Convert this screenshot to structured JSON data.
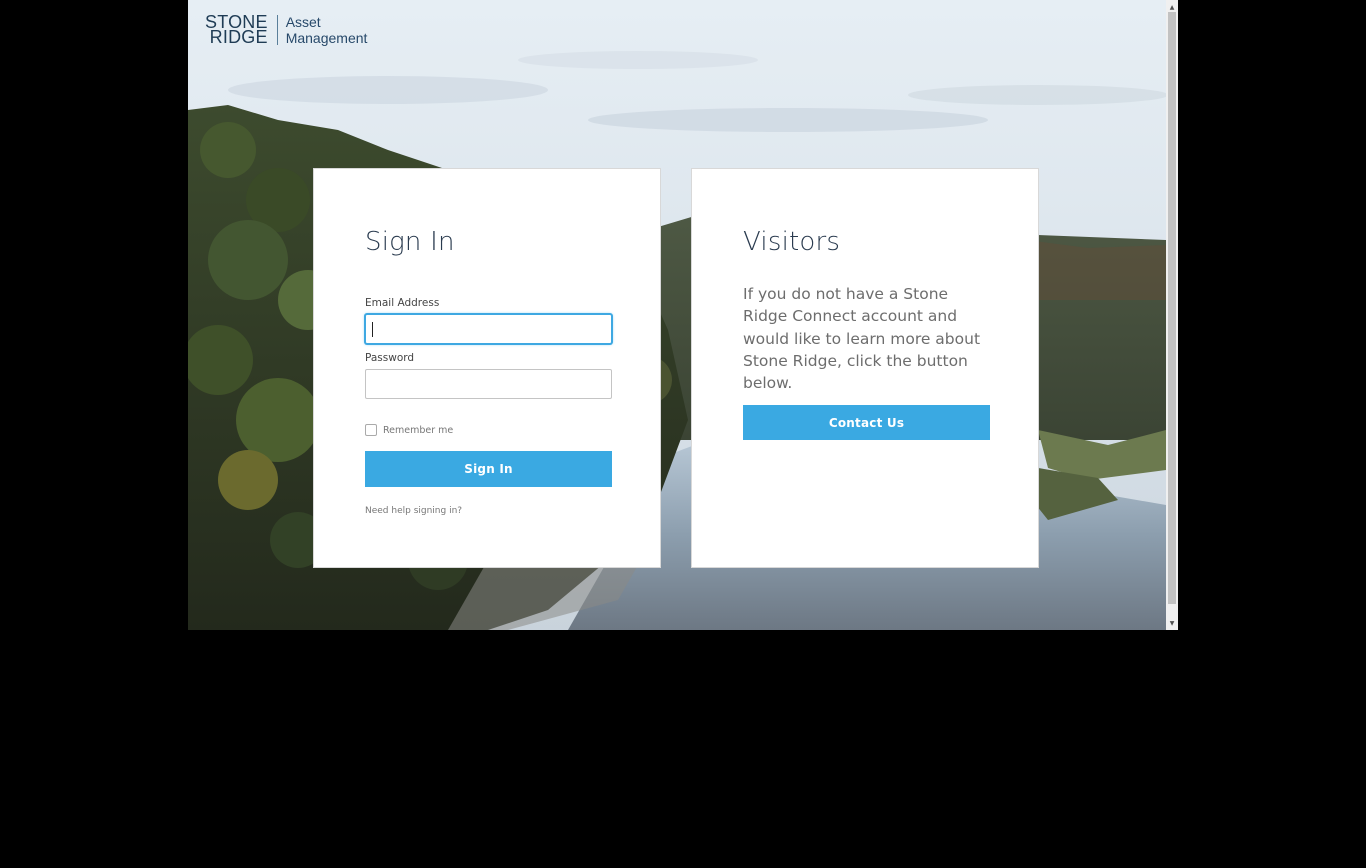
{
  "logo": {
    "line1": "STONE",
    "line2": "RIDGE",
    "sub1": "Asset",
    "sub2": "Management"
  },
  "signin": {
    "title": "Sign In",
    "email_label": "Email Address",
    "email_value": "",
    "password_label": "Password",
    "password_value": "",
    "remember_label": "Remember me",
    "remember_checked": false,
    "button_label": "Sign In",
    "help_link": "Need help signing in?"
  },
  "visitors": {
    "title": "Visitors",
    "body": "If you do not have a Stone Ridge Connect account and would like to learn more about Stone Ridge, click the button below.",
    "button_label": "Contact Us"
  },
  "colors": {
    "primary_button": "#3aa9e2",
    "focus_ring": "#3ea8e2",
    "heading": "#2a3b4f",
    "logo": "#1f3c55"
  },
  "icons": {
    "scroll_up": "scroll-up-arrow-icon",
    "scroll_down": "scroll-down-arrow-icon"
  }
}
